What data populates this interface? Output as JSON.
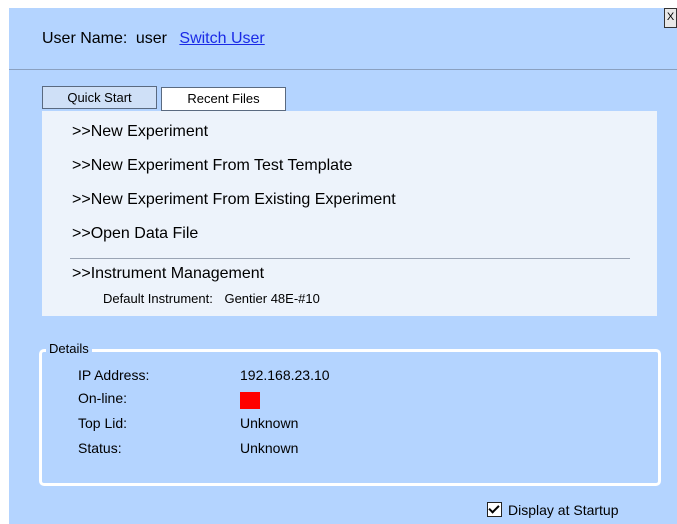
{
  "window": {
    "close_label": "X"
  },
  "user": {
    "label": "User Name:",
    "name": "user",
    "switch_label": "Switch User"
  },
  "tabs": [
    {
      "label": "Quick Start",
      "active": true
    },
    {
      "label": "Recent Files",
      "active": false
    }
  ],
  "quick_start": {
    "actions": [
      ">>New Experiment",
      ">>New Experiment From Test Template",
      ">>New Experiment From Existing Experiment",
      ">>Open Data File",
      ">>Instrument Management"
    ],
    "default_instrument_label": "Default Instrument:",
    "default_instrument_value": "Gentier 48E-#10"
  },
  "details": {
    "title": "Details",
    "rows": [
      {
        "label": "IP Address:",
        "value": "192.168.23.10"
      },
      {
        "label": "On-line:",
        "value": ""
      },
      {
        "label": "Top Lid:",
        "value": "Unknown"
      },
      {
        "label": "Status:",
        "value": "Unknown"
      }
    ],
    "online_color": "#ff0000"
  },
  "startup": {
    "label": "Display at Startup",
    "checked": true
  },
  "colors": {
    "background": "#b4d4ff",
    "panel": "#edf3fb",
    "link": "#1a2ae6"
  }
}
